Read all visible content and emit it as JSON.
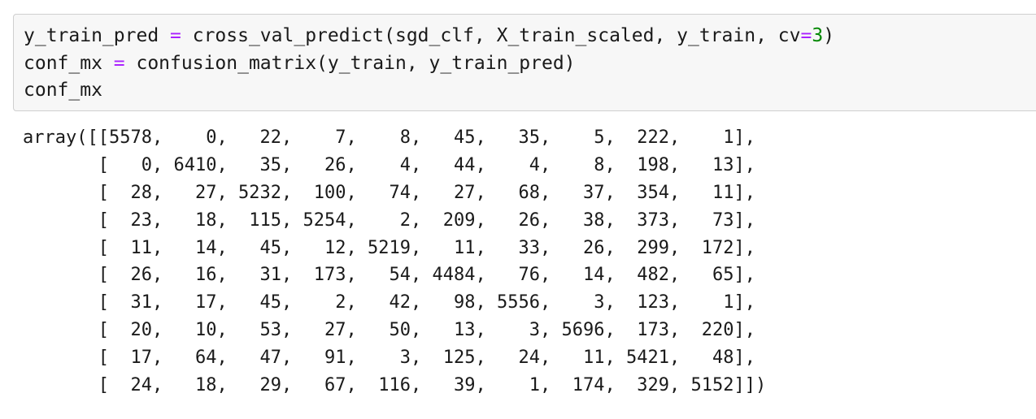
{
  "input_cell": {
    "lines": [
      [
        {
          "t": "y_train_pred ",
          "c": ""
        },
        {
          "t": "=",
          "c": "op"
        },
        {
          "t": " cross_val_predict(sgd_clf, X_train_scaled, y_train, cv",
          "c": ""
        },
        {
          "t": "=",
          "c": "op"
        },
        {
          "t": "3",
          "c": "num"
        },
        {
          "t": ")",
          "c": ""
        }
      ],
      [
        {
          "t": "conf_mx ",
          "c": ""
        },
        {
          "t": "=",
          "c": "op"
        },
        {
          "t": " confusion_matrix(y_train, y_train_pred)",
          "c": ""
        }
      ],
      [
        {
          "t": "conf_mx",
          "c": ""
        }
      ]
    ]
  },
  "output": {
    "prefix": "array(",
    "matrix": [
      [
        5578,
        0,
        22,
        7,
        8,
        45,
        35,
        5,
        222,
        1
      ],
      [
        0,
        6410,
        35,
        26,
        4,
        44,
        4,
        8,
        198,
        13
      ],
      [
        28,
        27,
        5232,
        100,
        74,
        27,
        68,
        37,
        354,
        11
      ],
      [
        23,
        18,
        115,
        5254,
        2,
        209,
        26,
        38,
        373,
        73
      ],
      [
        11,
        14,
        45,
        12,
        5219,
        11,
        33,
        26,
        299,
        172
      ],
      [
        26,
        16,
        31,
        173,
        54,
        4484,
        76,
        14,
        482,
        65
      ],
      [
        31,
        17,
        45,
        2,
        42,
        98,
        5556,
        3,
        123,
        1
      ],
      [
        20,
        10,
        53,
        27,
        50,
        13,
        3,
        5696,
        173,
        220
      ],
      [
        17,
        64,
        47,
        91,
        3,
        125,
        24,
        11,
        5421,
        48
      ],
      [
        24,
        18,
        29,
        67,
        116,
        39,
        1,
        174,
        329,
        5152
      ]
    ],
    "suffix": ")"
  }
}
